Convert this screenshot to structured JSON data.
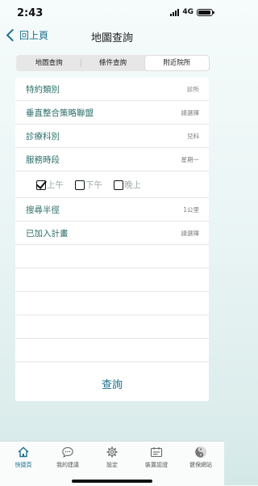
{
  "status": {
    "time": "2:43",
    "network": "4G"
  },
  "nav": {
    "back_label": "回上頁",
    "title": "地圖查詢"
  },
  "segments": [
    {
      "label": "地圖查詢",
      "active": false
    },
    {
      "label": "條件查詢",
      "active": false
    },
    {
      "label": "附近院所",
      "active": true
    }
  ],
  "form": {
    "rows": [
      {
        "label": "特約類別",
        "value": "診所"
      },
      {
        "label": "垂直整合策略聯盟",
        "value": "請選擇"
      },
      {
        "label": "診療科別",
        "value": "兒科"
      },
      {
        "label": "服務時段",
        "value": "星期一"
      }
    ],
    "periods": [
      {
        "label": "上午",
        "checked": true
      },
      {
        "label": "下午",
        "checked": false
      },
      {
        "label": "晚上",
        "checked": false
      }
    ],
    "radius": {
      "label": "搜尋半徑",
      "value": "1公里"
    },
    "plan": {
      "label": "已加入計畫",
      "value": "請選擇"
    }
  },
  "query_label": "查詢",
  "tabbar": [
    {
      "label": "快捷頁",
      "icon": "home-icon",
      "active": true
    },
    {
      "label": "我的建議",
      "icon": "chat-bubble-icon",
      "active": false
    },
    {
      "label": "設定",
      "icon": "gear-icon",
      "active": false
    },
    {
      "label": "裝置認證",
      "icon": "device-auth-icon",
      "active": false
    },
    {
      "label": "健保網站",
      "icon": "website-icon",
      "active": false
    }
  ],
  "colors": {
    "accent": "#1a6f8d",
    "label_text": "#2b6e6a",
    "value_text": "#7d7d7d"
  }
}
